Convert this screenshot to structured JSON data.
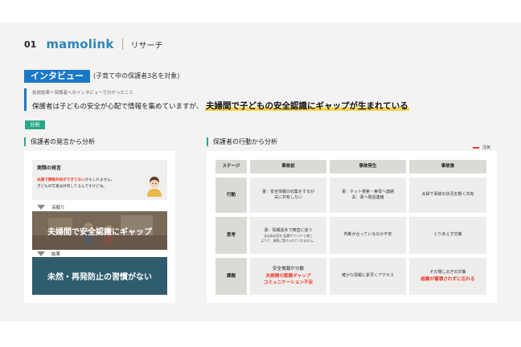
{
  "header": {
    "page_number": "01",
    "logo": "mamolink",
    "section": "リサーチ"
  },
  "interview": {
    "tag": "インタビュー",
    "note": "(子育て中の保護者3名を対象)"
  },
  "summary": {
    "sub": "仮説結果＋保護者へのインタビューで分かったこと",
    "main": "保護者は子どもの安全が心配で情報を集めていますが、",
    "highlight": "夫婦間で子どもの安全認識にギャップが生まれている"
  },
  "badge": "分析",
  "left": {
    "heading": "保護者の発言から分析",
    "quote": {
      "title": "実際の発言",
      "line1_red": "夫婦で情報共有ができてない",
      "line1_rest": "かもしれません。",
      "line2": "子どもの写真は共有してるんですけどね。"
    },
    "step1": "深掘り",
    "box1": "夫婦間で安全認識にギャップ",
    "step2": "結果",
    "box2": "未然・再発防止の習慣がない"
  },
  "right": {
    "heading": "保護者の行動から分析",
    "legend": "注目",
    "columns": [
      "ステージ",
      "事故前",
      "事故発生",
      "事故後"
    ],
    "rows": [
      {
        "stage": "行動",
        "before": {
          "lines": [
            "妻：安全情報の収集をするが",
            "夫に共有しない"
          ]
        },
        "during": {
          "lines": [
            "妻：ネット検索・実母へ連絡",
            "夫：妻へ電話連絡"
          ]
        },
        "after": {
          "lines": [
            "夫婦で事故の状況を軽く共有"
          ]
        }
      },
      {
        "stage": "思考",
        "before": {
          "lines": [
            "妻：情報過多で精査に迷う"
          ],
          "small": [
            "夫は私の話を\"話題サウンド\"と感じ",
            "ようで、真剣に受け入れてくれません。"
          ]
        },
        "during": {
          "lines": [
            "判断が合っているのか不安"
          ]
        },
        "after": {
          "lines": [
            "とりあえず対策"
          ]
        }
      },
      {
        "stage": "課題",
        "before": {
          "lines": [
            "安全情報が分散"
          ],
          "red": [
            "夫婦間の認識ギャップ",
            "コミュニケーション不足"
          ]
        },
        "during": {
          "lines": [
            "確かな情報に素早くアクセス"
          ]
        },
        "after": {
          "lines": [
            "その場しのぎの対策"
          ],
          "red": [
            "経験が蓄積されずに忘れる"
          ]
        }
      }
    ]
  },
  "colors": {
    "accent_blue": "#1a78c9",
    "accent_green": "#2aa68a",
    "highlight_yellow": "#f6d44a",
    "alert_red": "#e83a2e",
    "dark_box": "#2f5d6e"
  },
  "icons": [
    "person-avatar-icon",
    "triangle-down-icon"
  ]
}
